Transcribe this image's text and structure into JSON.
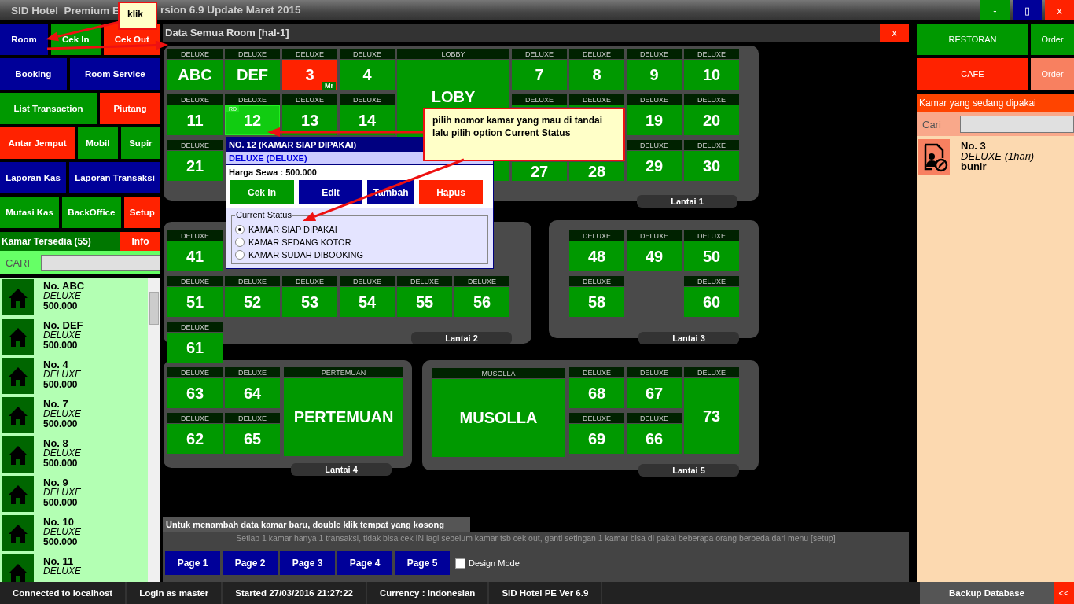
{
  "title_bar": {
    "title_parts": [
      "SID Hotel  Premium E",
      "rsion 6.9 Update Maret 2015"
    ],
    "window_buttons": [
      {
        "label": "-",
        "color": "#009900"
      },
      {
        "label": "▯",
        "color": "#000099"
      },
      {
        "label": "x",
        "color": "#ff2200"
      }
    ]
  },
  "callouts": [
    {
      "text": "klik"
    },
    {
      "text": "pilih nomor kamar yang mau di tandai lalu pilih option Current Status"
    }
  ],
  "menu_buttons": [
    [
      {
        "label": "Room",
        "color": "#000099"
      },
      {
        "label": "Cek In",
        "color": "#009900"
      },
      {
        "label": "Cek Out",
        "color": "#ff2200"
      }
    ],
    [
      {
        "label": "Booking",
        "color": "#000099"
      },
      {
        "label": "Room Service",
        "color": "#000099"
      }
    ],
    [
      {
        "label": "List Transaction",
        "color": "#009900"
      },
      {
        "label": "Piutang",
        "color": "#ff2200"
      }
    ],
    [
      {
        "label": "Antar Jemput",
        "color": "#ff2200"
      },
      {
        "label": "Mobil",
        "color": "#009900"
      },
      {
        "label": "Supir",
        "color": "#009900"
      }
    ],
    [
      {
        "label": "Laporan Kas",
        "color": "#000099"
      },
      {
        "label": "Laporan Transaksi",
        "color": "#000099"
      }
    ],
    [
      {
        "label": "Mutasi Kas",
        "color": "#009900"
      },
      {
        "label": "BackOffice",
        "color": "#009900"
      },
      {
        "label": "Setup",
        "color": "#ff2200"
      }
    ]
  ],
  "available_rooms": {
    "title": "Kamar Tersedia (55)",
    "info_button": "Info",
    "search_label": "CARI",
    "items": [
      {
        "name": "No. ABC",
        "type": "DELUXE",
        "price": "500.000"
      },
      {
        "name": "No. DEF",
        "type": "DELUXE",
        "price": "500.000"
      },
      {
        "name": "No. 4",
        "type": "DELUXE",
        "price": "500.000"
      },
      {
        "name": "No. 7",
        "type": "DELUXE",
        "price": "500.000"
      },
      {
        "name": "No. 8",
        "type": "DELUXE",
        "price": "500.000"
      },
      {
        "name": "No. 9",
        "type": "DELUXE",
        "price": "500.000"
      },
      {
        "name": "No. 10",
        "type": "DELUXE",
        "price": "500.000"
      },
      {
        "name": "No. 11",
        "type": "DELUXE"
      }
    ]
  },
  "room_window": {
    "title": "Data Semua Room [hal-1]",
    "close": "x",
    "floors": [
      {
        "label": "Lantai 1",
        "rooms": [
          {
            "type": "DELUXE",
            "number": "ABC",
            "color": "#009900",
            "selected": false
          },
          {
            "type": "DELUXE",
            "number": "DEF",
            "color": "#009900",
            "selected": false
          },
          {
            "type": "DELUXE",
            "number": "3",
            "color": "#ff2200",
            "selected": false,
            "badge": "Mr"
          },
          {
            "type": "DELUXE",
            "number": "4",
            "color": "#009900",
            "selected": false
          },
          {
            "type": "LOBBY",
            "number": "LOBY",
            "color": "#009900",
            "selected": false
          },
          {
            "type": "DELUXE",
            "number": "7",
            "color": "#009900",
            "selected": false
          },
          {
            "type": "DELUXE",
            "number": "8",
            "color": "#009900",
            "selected": false
          },
          {
            "type": "DELUXE",
            "number": "9",
            "color": "#009900",
            "selected": false
          },
          {
            "type": "DELUXE",
            "number": "10",
            "color": "#009900",
            "selected": false
          },
          {
            "type": "DELUXE",
            "number": "11",
            "color": "#009900",
            "selected": false
          },
          {
            "type": "DELUXE",
            "number": "12",
            "color": "#11cc11",
            "selected": true,
            "badge": "RD"
          },
          {
            "type": "DELUXE",
            "number": "13",
            "color": "#009900",
            "selected": false
          },
          {
            "type": "DELUXE",
            "number": "14",
            "color": "#009900",
            "selected": false
          },
          {
            "type": "DELUXE",
            "color": "#009900",
            "selected": false
          },
          {
            "type": "DELUXE",
            "color": "#009900",
            "selected": false
          },
          {
            "type": "DELUXE",
            "number": "19",
            "color": "#009900",
            "selected": false
          },
          {
            "type": "DELUXE",
            "number": "20",
            "color": "#009900",
            "selected": false
          },
          {
            "type": "DELUXE",
            "number": "21",
            "color": "#009900",
            "selected": false
          },
          {
            "number": "27",
            "color": "#009900",
            "selected": false
          },
          {
            "number": "28",
            "color": "#009900",
            "selected": false
          },
          {
            "type": "DELUXE",
            "number": "29",
            "color": "#009900",
            "selected": false
          },
          {
            "type": "DELUXE",
            "number": "30",
            "color": "#009900",
            "selected": false
          }
        ]
      },
      {
        "label": "Lantai 2",
        "rooms": [
          {
            "type": "DELUXE",
            "number": "41",
            "color": "#009900",
            "selected": false
          },
          {
            "type": "DELUXE",
            "number": "51",
            "color": "#009900",
            "selected": false
          },
          {
            "type": "DELUXE",
            "number": "52",
            "color": "#009900",
            "selected": false
          },
          {
            "type": "DELUXE",
            "number": "53",
            "color": "#009900",
            "selected": false
          },
          {
            "type": "DELUXE",
            "number": "54",
            "color": "#009900",
            "selected": false
          },
          {
            "type": "DELUXE",
            "number": "55",
            "color": "#009900",
            "selected": false
          },
          {
            "type": "DELUXE",
            "number": "56",
            "color": "#009900",
            "selected": false
          },
          {
            "type": "DELUXE",
            "number": "61",
            "color": "#009900",
            "selected": false
          }
        ]
      },
      {
        "label": "Lantai 3",
        "rooms": [
          {
            "type": "DELUXE",
            "number": "48",
            "color": "#009900",
            "selected": false
          },
          {
            "type": "DELUXE",
            "number": "49",
            "color": "#009900",
            "selected": false
          },
          {
            "type": "DELUXE",
            "number": "50",
            "color": "#009900",
            "selected": false
          },
          {
            "type": "DELUXE",
            "number": "58",
            "color": "#009900",
            "selected": false
          },
          {
            "type": "DELUXE",
            "number": "60",
            "color": "#009900",
            "selected": false
          }
        ]
      },
      {
        "label": "Lantai 4",
        "rooms": [
          {
            "type": "DELUXE",
            "number": "63",
            "color": "#009900",
            "selected": false
          },
          {
            "type": "DELUXE",
            "number": "64",
            "color": "#009900",
            "selected": false
          },
          {
            "type": "PERTEMUAN",
            "number": "PERTEMUAN",
            "color": "#009900",
            "selected": false
          },
          {
            "type": "DELUXE",
            "number": "62",
            "color": "#009900",
            "selected": false
          },
          {
            "type": "DELUXE",
            "number": "65",
            "color": "#009900",
            "selected": false
          }
        ]
      },
      {
        "label": "Lantai 5",
        "rooms": [
          {
            "type": "MUSOLLA",
            "number": "MUSOLLA",
            "color": "#009900",
            "selected": false
          },
          {
            "type": "DELUXE",
            "number": "68",
            "color": "#009900",
            "selected": false
          },
          {
            "type": "DELUXE",
            "number": "67",
            "color": "#009900",
            "selected": false
          },
          {
            "type": "DELUXE",
            "number": "73",
            "color": "#009900",
            "selected": false
          },
          {
            "type": "DELUXE",
            "number": "69",
            "color": "#009900",
            "selected": false
          },
          {
            "type": "DELUXE",
            "number": "66",
            "color": "#009900",
            "selected": false
          }
        ]
      }
    ],
    "popup": {
      "title": "NO. 12 (KAMAR SIAP DIPAKAI)",
      "subtitle": "DELUXE (DELUXE)",
      "price": "Harga Sewa : 500.000",
      "buttons": [
        {
          "label": "Cek In",
          "color": "#009900"
        },
        {
          "label": "Edit",
          "color": "#000099"
        },
        {
          "label": "Tambah",
          "color": "#000099"
        },
        {
          "label": "Hapus",
          "color": "#ff2200"
        }
      ],
      "status_legend": "Current Status",
      "options": [
        {
          "label": "KAMAR SIAP DIPAKAI",
          "selected": true
        },
        {
          "label": "KAMAR SEDANG KOTOR",
          "selected": false
        },
        {
          "label": "KAMAR SUDAH DIBOOKING",
          "selected": false
        }
      ]
    },
    "hint": "Untuk menambah data kamar baru, double klik tempat yang kosong",
    "note": "Setiap 1 kamar hanya 1 transaksi, tidak bisa cek IN lagi sebelum kamar tsb cek out, ganti setingan 1 kamar bisa di pakai beberapa orang berbeda dari menu [setup]",
    "pages": [
      "Page 1",
      "Page 2",
      "Page 3",
      "Page 4",
      "Page 5"
    ],
    "design_mode": {
      "label": "Design Mode",
      "checked": false
    }
  },
  "right_panel": {
    "buttons": [
      [
        {
          "label": "RESTORAN",
          "color": "#009900"
        },
        {
          "label": "Order",
          "color": "#009900"
        }
      ],
      [
        {
          "label": "CAFE",
          "color": "#ff2200"
        },
        {
          "label": "Order",
          "color": "#f88060"
        }
      ]
    ],
    "header": "Kamar yang sedang dipakai",
    "search_label": "Cari",
    "items": [
      {
        "name": "No. 3",
        "type": "DELUXE (1hari)",
        "guest": "bunir"
      }
    ]
  },
  "status_bar": {
    "items": [
      "Connected to localhost",
      "Login as master",
      "Started 27/03/2016 21:27:22",
      "Currency : Indonesian",
      "SID Hotel PE Ver 6.9"
    ],
    "backup": "Backup Database",
    "collapse": "<<"
  }
}
